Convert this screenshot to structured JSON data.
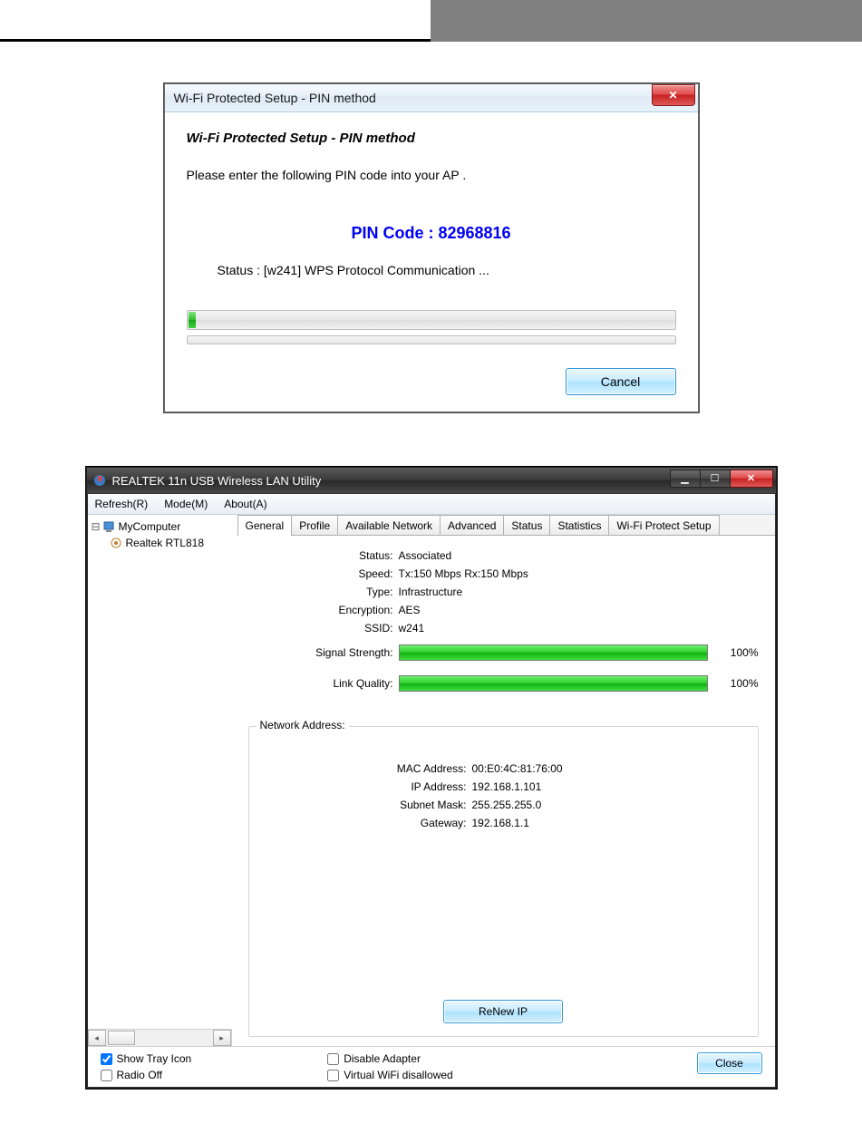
{
  "dialog": {
    "title": "Wi-Fi Protected Setup - PIN method",
    "heading": "Wi-Fi Protected Setup - PIN method",
    "message": "Please enter the following PIN code into your AP .",
    "pin_label": "PIN Code :  82968816",
    "status": "Status : [w241] WPS Protocol Communication ...",
    "cancel": "Cancel"
  },
  "app": {
    "title": "REALTEK 11n USB Wireless LAN Utility",
    "menu": [
      "Refresh(R)",
      "Mode(M)",
      "About(A)"
    ],
    "tree": {
      "root": "MyComputer",
      "child": "Realtek RTL818"
    },
    "tabs": [
      "General",
      "Profile",
      "Available Network",
      "Advanced",
      "Status",
      "Statistics",
      "Wi-Fi Protect Setup"
    ],
    "general": {
      "status_label": "Status:",
      "status_value": "Associated",
      "speed_label": "Speed:",
      "speed_value": "Tx:150 Mbps Rx:150 Mbps",
      "type_label": "Type:",
      "type_value": "Infrastructure",
      "encryption_label": "Encryption:",
      "encryption_value": "AES",
      "ssid_label": "SSID:",
      "ssid_value": "w241",
      "signal_label": "Signal Strength:",
      "signal_pct": "100%",
      "link_label": "Link Quality:",
      "link_pct": "100%",
      "na_legend": "Network Address:",
      "mac_label": "MAC Address:",
      "mac_value": "00:E0:4C:81:76:00",
      "ip_label": "IP Address:",
      "ip_value": "192.168.1.101",
      "subnet_label": "Subnet Mask:",
      "subnet_value": "255.255.255.0",
      "gateway_label": "Gateway:",
      "gateway_value": "192.168.1.1",
      "renew": "ReNew IP"
    },
    "footer": {
      "show_tray": "Show Tray Icon",
      "radio_off": "Radio Off",
      "disable_adapter": "Disable Adapter",
      "virtual_wifi": "Virtual WiFi disallowed",
      "close": "Close"
    }
  }
}
